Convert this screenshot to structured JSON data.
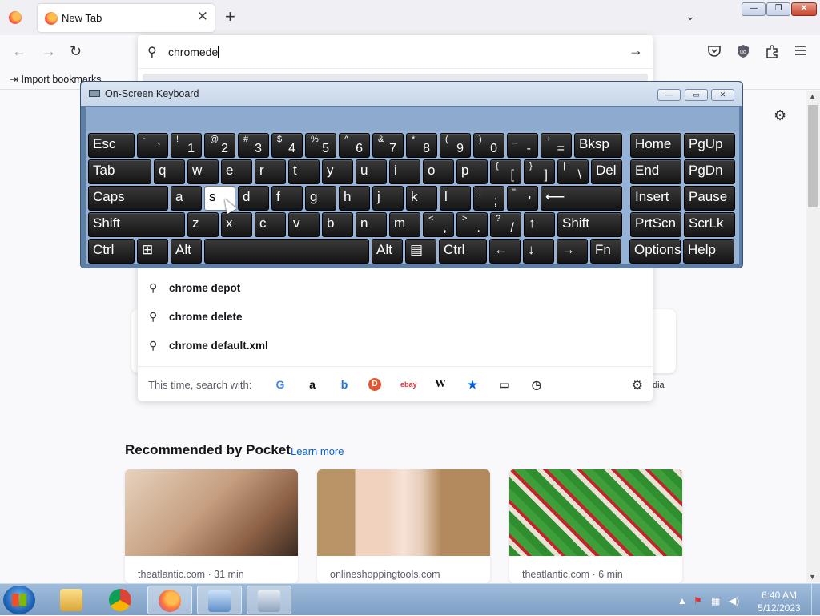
{
  "browser": {
    "tab_title": "New Tab",
    "tab_close": "✕",
    "new_tab": "+",
    "list_tabs": "⌄",
    "bookmark_import": "Import bookmarks",
    "window_controls": {
      "minimize": "—",
      "maximize": "❐",
      "close": "✕"
    }
  },
  "nav": {
    "back": "←",
    "forward": "→",
    "reload": "↻",
    "go": "→"
  },
  "urlbar": {
    "value": "chromede",
    "suggestions": [
      "chrome depot",
      "chrome delete",
      "chrome default.xml"
    ],
    "search_with_label": "This time, search with:",
    "engines": [
      "G",
      "a",
      "b",
      "D",
      "ebay",
      "W",
      "★",
      "▭",
      "◷"
    ]
  },
  "page": {
    "pocket_title": "Recommended by Pocket",
    "learn_more": "Learn more",
    "shortcut_label": "dia",
    "cards": [
      {
        "source": "theatlantic.com · 31 min"
      },
      {
        "source": "onlineshoppingtools.com"
      },
      {
        "source": "theatlantic.com · 6 min"
      }
    ]
  },
  "osk": {
    "title": "On-Screen Keyboard",
    "controls": {
      "minimize": "—",
      "restore": "▭",
      "close": "✕"
    },
    "rows": [
      [
        {
          "main": "Esc",
          "w": 58
        },
        {
          "shift": "~",
          "base": "`",
          "w": 39
        },
        {
          "shift": "!",
          "base": "1",
          "w": 39
        },
        {
          "shift": "@",
          "base": "2",
          "w": 39
        },
        {
          "shift": "#",
          "base": "3",
          "w": 39
        },
        {
          "shift": "$",
          "base": "4",
          "w": 39
        },
        {
          "shift": "%",
          "base": "5",
          "w": 39
        },
        {
          "shift": "^",
          "base": "6",
          "w": 39
        },
        {
          "shift": "&",
          "base": "7",
          "w": 39
        },
        {
          "shift": "*",
          "base": "8",
          "w": 39
        },
        {
          "shift": "(",
          "base": "9",
          "w": 39
        },
        {
          "shift": ")",
          "base": "0",
          "w": 39
        },
        {
          "shift": "_",
          "base": "-",
          "w": 39
        },
        {
          "shift": "+",
          "base": "=",
          "w": 39
        },
        {
          "main": "Bksp",
          "w": 60
        },
        {
          "main": "Home",
          "w": 64,
          "gap": 7
        },
        {
          "main": "PgUp",
          "w": 64
        }
      ],
      [
        {
          "main": "Tab",
          "w": 79
        },
        {
          "main": "q",
          "w": 39
        },
        {
          "main": "w",
          "w": 39
        },
        {
          "main": "e",
          "w": 39
        },
        {
          "main": "r",
          "w": 39
        },
        {
          "main": "t",
          "w": 39
        },
        {
          "main": "y",
          "w": 39
        },
        {
          "main": "u",
          "w": 39
        },
        {
          "main": "i",
          "w": 39
        },
        {
          "main": "o",
          "w": 39
        },
        {
          "main": "p",
          "w": 39
        },
        {
          "shift": "{",
          "base": "[",
          "w": 39
        },
        {
          "shift": "}",
          "base": "]",
          "w": 39
        },
        {
          "shift": "|",
          "base": "\\",
          "w": 39
        },
        {
          "main": "Del",
          "w": 39
        },
        {
          "main": "End",
          "w": 64,
          "gap": 7
        },
        {
          "main": "PgDn",
          "w": 64
        }
      ],
      [
        {
          "main": "Caps",
          "w": 100
        },
        {
          "main": "a",
          "w": 39
        },
        {
          "main": "s",
          "w": 39,
          "pressed": true
        },
        {
          "main": "d",
          "w": 39
        },
        {
          "main": "f",
          "w": 39
        },
        {
          "main": "g",
          "w": 39
        },
        {
          "main": "h",
          "w": 39
        },
        {
          "main": "j",
          "w": 39
        },
        {
          "main": "k",
          "w": 39
        },
        {
          "main": "l",
          "w": 39
        },
        {
          "shift": ":",
          "base": ";",
          "w": 39
        },
        {
          "shift": "\"",
          "base": "'",
          "w": 39
        },
        {
          "main": "⟵",
          "w": 102
        },
        {
          "main": "Insert",
          "w": 64,
          "gap": 7
        },
        {
          "main": "Pause",
          "w": 64
        }
      ],
      [
        {
          "main": "Shift",
          "w": 121
        },
        {
          "main": "z",
          "w": 39
        },
        {
          "main": "x",
          "w": 39
        },
        {
          "main": "c",
          "w": 39
        },
        {
          "main": "v",
          "w": 39
        },
        {
          "main": "b",
          "w": 39
        },
        {
          "main": "n",
          "w": 39
        },
        {
          "main": "m",
          "w": 39
        },
        {
          "shift": "<",
          "base": ",",
          "w": 39
        },
        {
          "shift": ">",
          "base": ".",
          "w": 39
        },
        {
          "shift": "?",
          "base": "/",
          "w": 39
        },
        {
          "main": "↑",
          "w": 39
        },
        {
          "main": "Shift",
          "w": 81
        },
        {
          "main": "PrtScn",
          "w": 64,
          "gap": 7
        },
        {
          "main": "ScrLk",
          "w": 64
        }
      ],
      [
        {
          "main": "Ctrl",
          "w": 58
        },
        {
          "main": "⊞",
          "w": 39
        },
        {
          "main": "Alt",
          "w": 39
        },
        {
          "main": "",
          "w": 206
        },
        {
          "main": "Alt",
          "w": 39
        },
        {
          "main": "▤",
          "w": 39
        },
        {
          "main": "Ctrl",
          "w": 60
        },
        {
          "main": "←",
          "w": 39
        },
        {
          "main": "↓",
          "w": 39
        },
        {
          "main": "→",
          "w": 39
        },
        {
          "main": "Fn",
          "w": 39
        },
        {
          "main": "Options",
          "w": 64,
          "gap": 7
        },
        {
          "main": "Help",
          "w": 64
        }
      ]
    ]
  },
  "taskbar": {
    "time": "6:40 AM",
    "date": "5/12/2023",
    "active_app": "firefox"
  }
}
